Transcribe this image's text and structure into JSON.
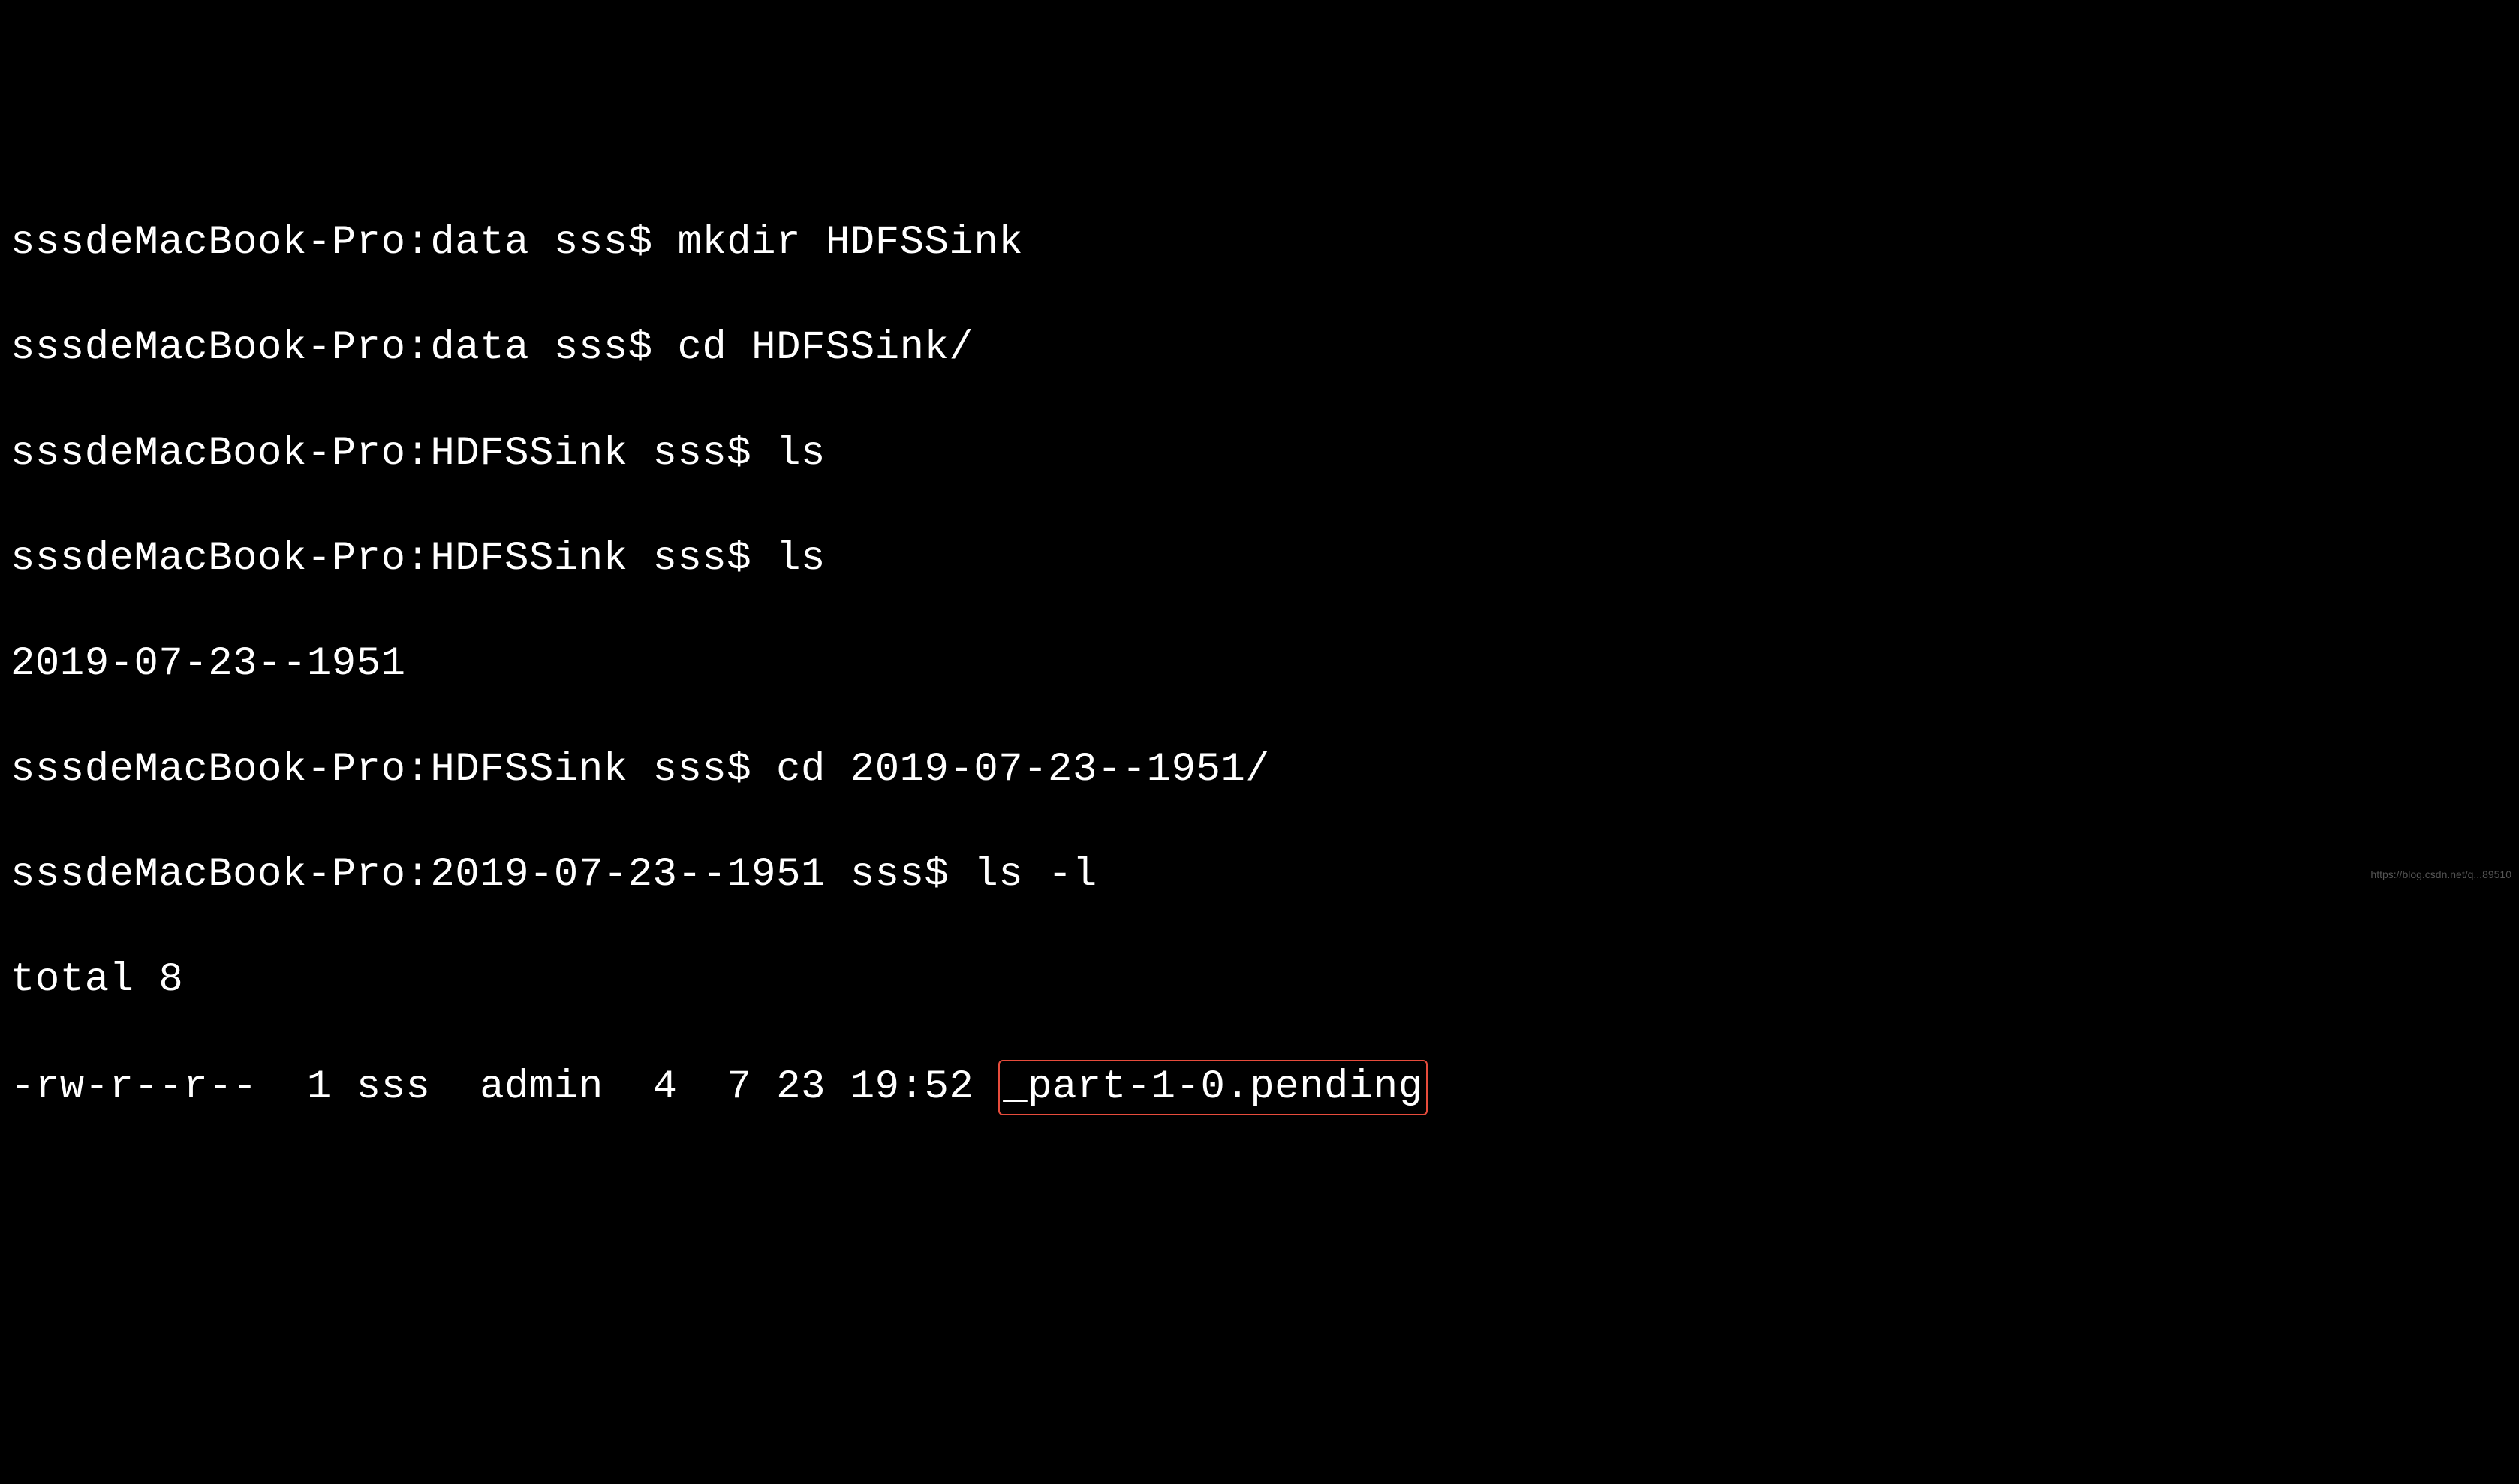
{
  "lines": [
    {
      "prompt": "sssdeMacBook-Pro:data sss$ ",
      "command": "mkdir HDFSSink"
    },
    {
      "prompt": "sssdeMacBook-Pro:data sss$ ",
      "command": "cd HDFSSink/"
    },
    {
      "prompt": "sssdeMacBook-Pro:HDFSSink sss$ ",
      "command": "ls"
    },
    {
      "prompt": "sssdeMacBook-Pro:HDFSSink sss$ ",
      "command": "ls"
    },
    {
      "output": "2019-07-23--1951"
    },
    {
      "prompt": "sssdeMacBook-Pro:HDFSSink sss$ ",
      "command": "cd 2019-07-23--1951/"
    },
    {
      "prompt": "sssdeMacBook-Pro:2019-07-23--1951 sss$ ",
      "command": "ls -l"
    },
    {
      "output": "total 8"
    }
  ],
  "lastLine": {
    "details": "-rw-r--r--  1 sss  admin  4  7 23 19:52 ",
    "highlighted": "_part-1-0.pending"
  },
  "watermark": "https://blog.csdn.net/q...89510"
}
